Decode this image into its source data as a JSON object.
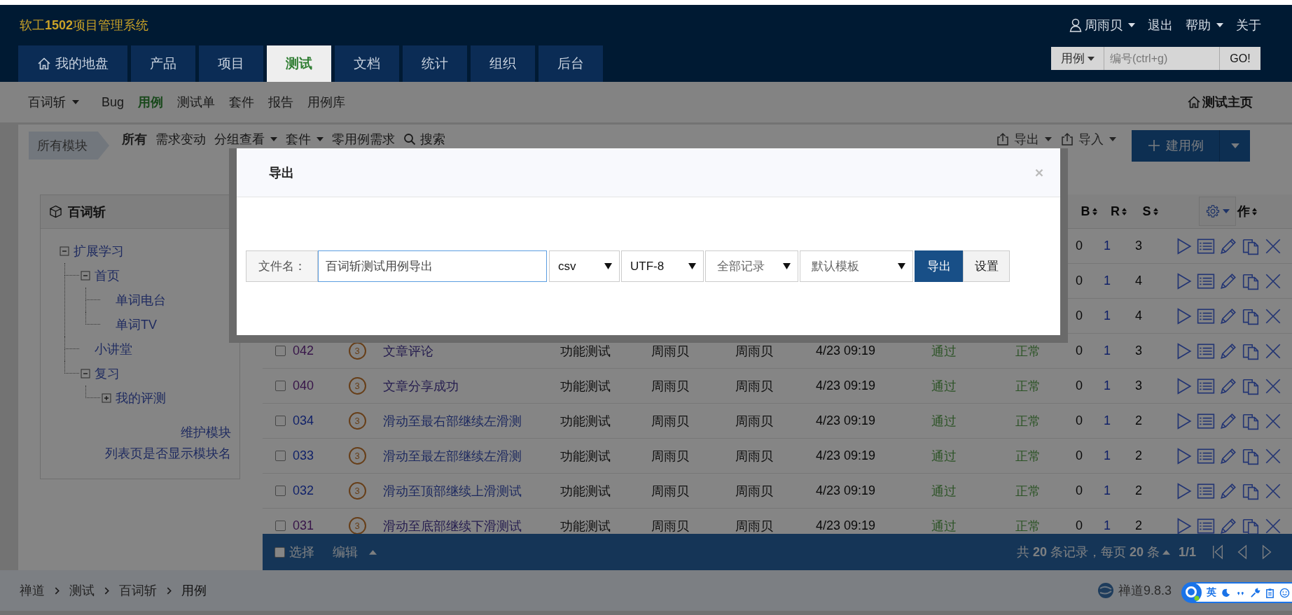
{
  "header": {
    "title": "软工**1502**项目管理系统",
    "user": "周雨贝",
    "links": [
      {
        "label": "退出",
        "dropdown": false
      },
      {
        "label": "帮助",
        "dropdown": true
      },
      {
        "label": "关于",
        "dropdown": false
      }
    ]
  },
  "nav_tabs": [
    {
      "label": "我的地盘",
      "selected": false
    },
    {
      "label": "产品",
      "selected": false
    },
    {
      "label": "项目",
      "selected": false
    },
    {
      "label": "测试",
      "selected": true
    },
    {
      "label": "文档",
      "selected": false
    },
    {
      "label": "统计",
      "selected": false
    },
    {
      "label": "组织",
      "selected": false
    },
    {
      "label": "后台",
      "selected": false
    }
  ],
  "quick_search": {
    "type_label": "用例",
    "placeholder": "编号(ctrl+g)",
    "button": "GO!"
  },
  "subnav": {
    "product": "百词斩",
    "items": [
      {
        "label": "Bug",
        "selected": false
      },
      {
        "label": "用例",
        "selected": true
      },
      {
        "label": "测试单",
        "selected": false
      },
      {
        "label": "套件",
        "selected": false
      },
      {
        "label": "报告",
        "selected": false
      },
      {
        "label": "用例库",
        "selected": false
      }
    ],
    "home_link": "测试主页"
  },
  "filter_bar": {
    "module_chip": "所有模块",
    "items": [
      {
        "label": "所有",
        "kind": "plain",
        "selected": true
      },
      {
        "label": "需求变动",
        "kind": "plain",
        "selected": false
      },
      {
        "label": "分组查看",
        "kind": "dropdown",
        "selected": false
      },
      {
        "label": "套件",
        "kind": "dropdown",
        "selected": false
      },
      {
        "label": "零用例需求",
        "kind": "plain",
        "selected": false
      },
      {
        "label": "搜索",
        "kind": "search",
        "selected": false
      }
    ],
    "export": "导出",
    "import": "导入",
    "create": "建用例"
  },
  "module_tree": {
    "title": "百词斩",
    "nodes": [
      {
        "label": "扩展学习",
        "expanded": true,
        "children": [
          {
            "label": "首页",
            "expanded": true,
            "children": [
              {
                "label": "单词电台"
              },
              {
                "label": "单词TV"
              }
            ]
          },
          {
            "label": "小讲堂"
          },
          {
            "label": "复习",
            "expanded": true,
            "children": [
              {
                "label": "我的评测",
                "expanded": false
              }
            ]
          }
        ]
      }
    ],
    "links": [
      "维护模块",
      "列表页是否显示模块名"
    ]
  },
  "table": {
    "columns": [
      "B",
      "R",
      "S",
      "作"
    ],
    "rows": [
      {
        "b": "0",
        "r": "1",
        "s": "3"
      },
      {
        "b": "0",
        "r": "1",
        "s": "4"
      },
      {
        "b": "0",
        "r": "1",
        "s": "4"
      },
      {
        "checked": false,
        "id": "042",
        "visited": true,
        "priority": "3",
        "title": "文章评论",
        "type": "功能测试",
        "creator": "周雨贝",
        "executor": "周雨贝",
        "date": "4/23 09:19",
        "result": "通过",
        "status": "正常",
        "b": "0",
        "r": "1",
        "s": "3"
      },
      {
        "checked": false,
        "id": "040",
        "visited": true,
        "priority": "3",
        "title": "文章分享成功",
        "type": "功能测试",
        "creator": "周雨贝",
        "executor": "周雨贝",
        "date": "4/23 09:19",
        "result": "通过",
        "status": "正常",
        "b": "0",
        "r": "1",
        "s": "3"
      },
      {
        "checked": false,
        "id": "034",
        "visited": false,
        "priority": "3",
        "title": "滑动至最右部继续左滑测",
        "type": "功能测试",
        "creator": "周雨贝",
        "executor": "周雨贝",
        "date": "4/23 09:19",
        "result": "通过",
        "status": "正常",
        "b": "0",
        "r": "1",
        "s": "2"
      },
      {
        "checked": false,
        "id": "033",
        "visited": false,
        "priority": "3",
        "title": "滑动至最左部继续左滑测",
        "type": "功能测试",
        "creator": "周雨贝",
        "executor": "周雨贝",
        "date": "4/23 09:19",
        "result": "通过",
        "status": "正常",
        "b": "0",
        "r": "1",
        "s": "2"
      },
      {
        "checked": false,
        "id": "032",
        "visited": false,
        "priority": "3",
        "title": "滑动至顶部继续上滑测试",
        "type": "功能测试",
        "creator": "周雨贝",
        "executor": "周雨贝",
        "date": "4/23 09:19",
        "result": "通过",
        "status": "正常",
        "b": "0",
        "r": "1",
        "s": "2"
      },
      {
        "checked": false,
        "id": "031",
        "visited": true,
        "priority": "3",
        "title": "滑动至底部继续下滑测试",
        "type": "功能测试",
        "creator": "周雨贝",
        "executor": "周雨贝",
        "date": "4/23 09:19",
        "result": "通过",
        "status": "正常",
        "b": "0",
        "r": "1",
        "s": "2"
      }
    ]
  },
  "footer_bar": {
    "select_checked": false,
    "select_label": "选择",
    "edit_label": "编辑",
    "summary": "共 **20** 条记录，每页 **20** 条",
    "page": "1/1"
  },
  "status_bar": {
    "breadcrumb": [
      "禅道",
      "测试",
      "百词斩",
      "用例"
    ],
    "version": "禅道9.8.3"
  },
  "ime": {
    "mode": "英"
  },
  "export_dialog": {
    "title": "导出",
    "filename_label": "文件名：",
    "filename": "百词斩测试用例导出",
    "selects": [
      "csv",
      "UTF-8",
      "全部记录",
      "默认模板"
    ],
    "primary": "导出",
    "secondary": "设置"
  }
}
